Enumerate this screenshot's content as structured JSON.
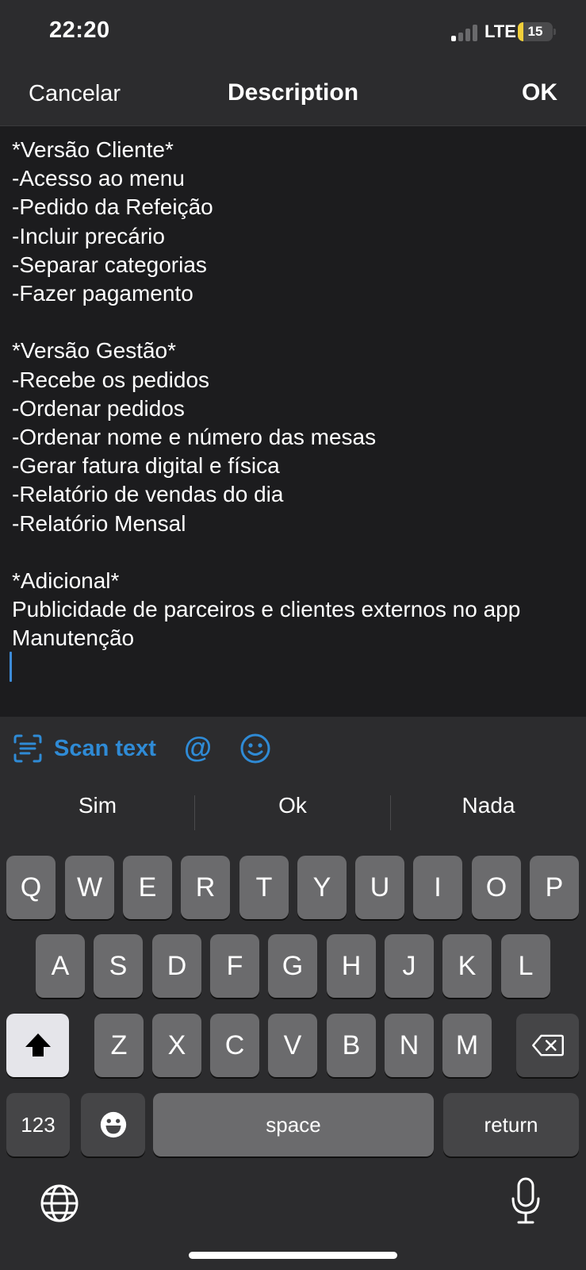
{
  "status_bar": {
    "time": "22:20",
    "network": "LTE",
    "battery": "15",
    "battery_level_percent": 15
  },
  "nav": {
    "cancel_label": "Cancelar",
    "title": "Description",
    "ok_label": "OK"
  },
  "editor": {
    "lines": [
      "*Versão Cliente*",
      "-Acesso ao menu",
      "-Pedido da Refeição",
      "-Incluir precário",
      "-Separar categorias",
      "-Fazer pagamento",
      "",
      "*Versão Gestão*",
      "-Recebe os pedidos",
      "-Ordenar pedidos",
      "-Ordenar nome e número das mesas",
      "-Gerar fatura digital e física",
      "-Relatório de vendas do dia",
      "-Relatório Mensal",
      "",
      "*Adicional*",
      "Publicidade de parceiros e clientes externos no app",
      "Manutenção"
    ]
  },
  "accessory": {
    "scan_text_label": "Scan text",
    "mention_symbol": "@",
    "icons": [
      "scan-text-icon",
      "smiley-icon"
    ]
  },
  "keyboard": {
    "suggestions": [
      "Sim",
      "Ok",
      "Nada"
    ],
    "rows": [
      [
        "Q",
        "W",
        "E",
        "R",
        "T",
        "Y",
        "U",
        "I",
        "O",
        "P"
      ],
      [
        "A",
        "S",
        "D",
        "F",
        "G",
        "H",
        "J",
        "K",
        "L"
      ],
      [
        "Z",
        "X",
        "C",
        "V",
        "B",
        "N",
        "M"
      ]
    ],
    "numbers_label": "123",
    "space_label": "space",
    "return_label": "return",
    "icons": [
      "shift-icon",
      "delete-icon",
      "emoji-icon",
      "globe-icon",
      "microphone-icon"
    ]
  },
  "colors": {
    "accent": "#2f8bd6",
    "background": "#1c1c1e",
    "bar": "#2c2c2e",
    "key": "#6b6b6d",
    "special_key": "#454547",
    "battery": "#f2cf3a"
  }
}
